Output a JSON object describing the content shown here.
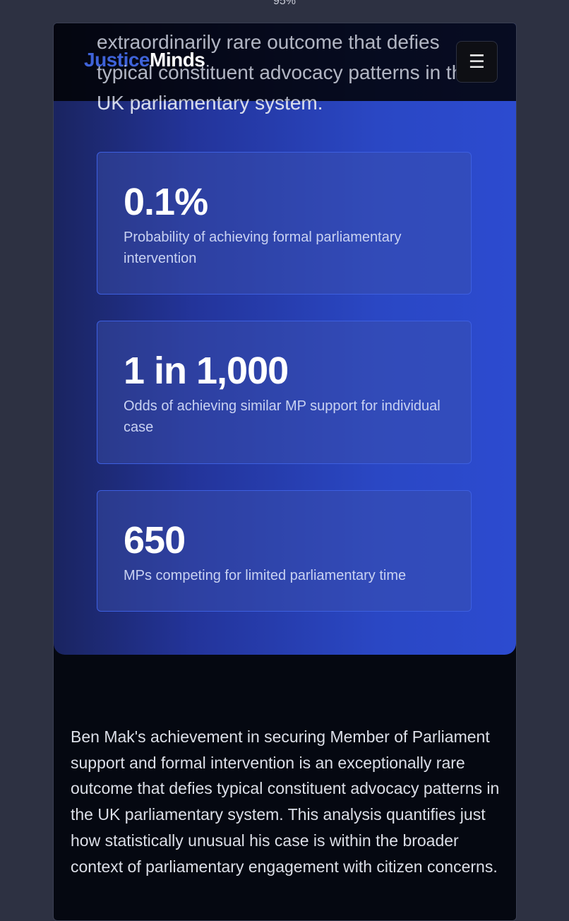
{
  "browser": {
    "zoom_label": "95%"
  },
  "nav": {
    "logo_part1": "Justice",
    "logo_part2": "Minds",
    "menu_icon": "☰",
    "menu_icon_name": "hamburger-menu-icon"
  },
  "hero": {
    "intro_text": "extraordinarily rare outcome that defies typical constituent advocacy patterns in the UK parliamentary system."
  },
  "stats": [
    {
      "value": "0.1%",
      "description": "Probability of achieving formal parliamentary intervention"
    },
    {
      "value": "1 in 1,000",
      "description": "Odds of achieving similar MP support for individual case"
    },
    {
      "value": "650",
      "description": "MPs competing for limited parliamentary time"
    }
  ],
  "body": {
    "paragraph": "Ben Mak's achievement in securing Member of Parliament support and formal intervention is an exceptionally rare outcome that defies typical constituent advocacy patterns in the UK parliamentary system. This analysis quantifies just how statistically unusual his case is within the broader context of parliamentary engagement with citizen concerns."
  },
  "colors": {
    "brand_blue": "#3f63d9",
    "hero_gradient_start": "#1a2460",
    "hero_gradient_end": "#2c4bd0",
    "card_border": "#3d5fe0",
    "page_background": "#050811"
  }
}
